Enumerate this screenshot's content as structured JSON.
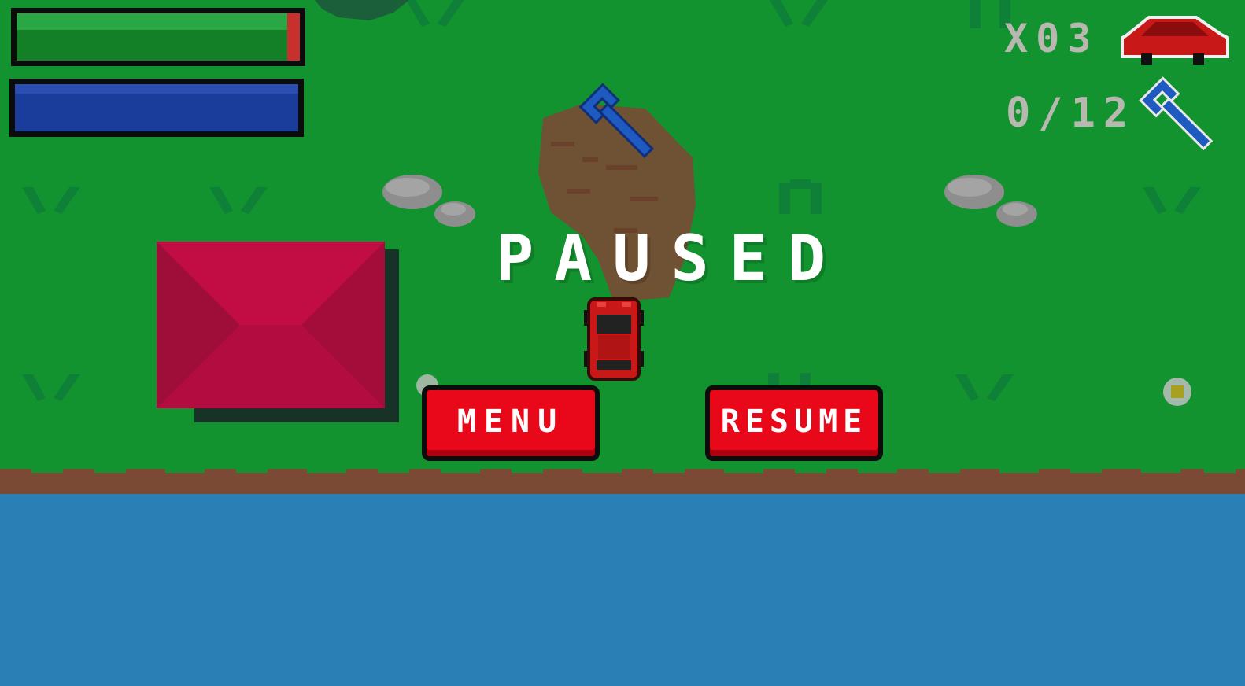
{
  "game": {
    "state": "PAUSED",
    "colors": {
      "grass": "#12932f",
      "dirt": "#7a4a34",
      "water": "#2a7fb4",
      "health_fill": "#138028",
      "health_cap": "#c8302e",
      "energy_fill": "#1a3d9c",
      "button_red": "#e8081a",
      "tent_pink": "#c10c44",
      "hud_text": "#b8b8b0"
    }
  },
  "hud": {
    "health": {
      "level": 0.96,
      "icon": "health-bar"
    },
    "energy": {
      "level": 0.97,
      "icon": "energy-bar"
    },
    "lives": {
      "text": "X03",
      "icon": "red-car-icon"
    },
    "wrenches": {
      "text": "0/12",
      "collected": 0,
      "total": 12,
      "icon": "wrench-icon"
    }
  },
  "overlay": {
    "title": "PAUSED",
    "buttons": {
      "menu_label": "MENU",
      "resume_label": "RESUME"
    }
  },
  "world": {
    "objects": [
      "tent",
      "rocks",
      "dirt-patch",
      "wrench-pickup",
      "player-car",
      "flowers",
      "river"
    ]
  }
}
